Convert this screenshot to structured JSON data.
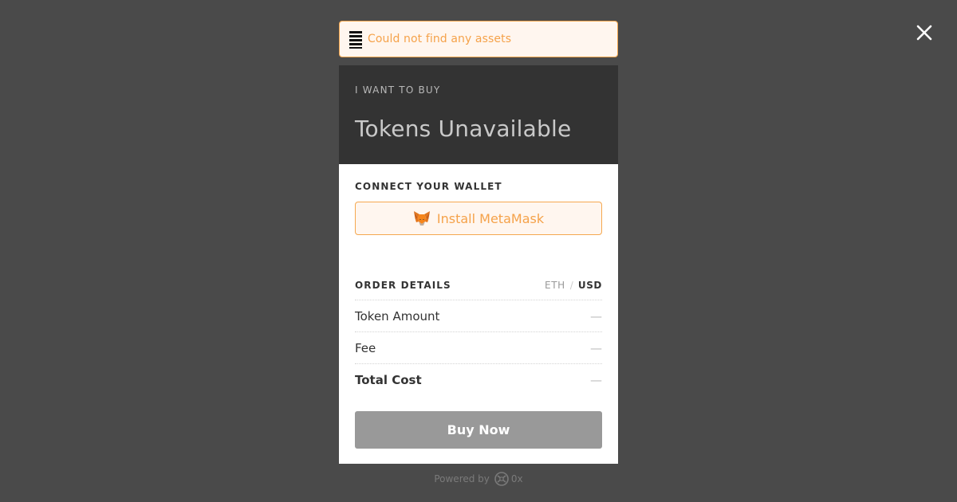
{
  "alert": {
    "message": "Could not find any assets",
    "icon": "list-icon"
  },
  "close": {
    "icon": "close-icon"
  },
  "header": {
    "label": "I WANT TO BUY",
    "title": "Tokens Unavailable"
  },
  "wallet": {
    "label": "CONNECT YOUR WALLET",
    "button_label": "Install MetaMask",
    "button_icon": "metamask-fox-icon"
  },
  "order": {
    "label": "ORDER DETAILS",
    "currency": {
      "eth": "ETH",
      "separator": "/",
      "usd": "USD",
      "selected": "USD"
    },
    "rows": [
      {
        "label": "Token Amount",
        "value": "—"
      },
      {
        "label": "Fee",
        "value": "—"
      },
      {
        "label": "Total Cost",
        "value": "—"
      }
    ]
  },
  "buy": {
    "label": "Buy Now"
  },
  "footer": {
    "powered_by": "Powered by",
    "brand": "0x",
    "brand_icon": "0x-logo-icon"
  },
  "colors": {
    "overlay": "#4a4a4a",
    "header_bg": "#333333",
    "accent": "#f5a84f",
    "accent_bg": "#fff6ef",
    "button_disabled": "#999999"
  }
}
